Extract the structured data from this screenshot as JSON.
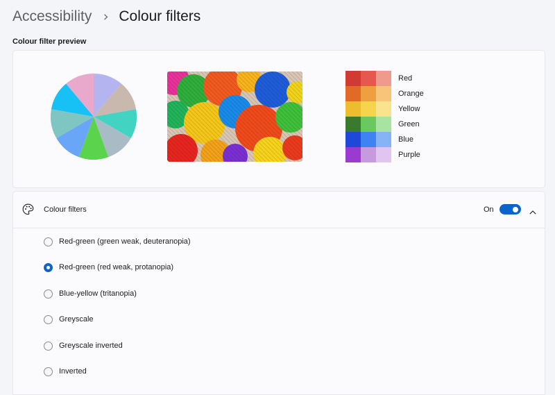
{
  "breadcrumb": {
    "parent": "Accessibility",
    "current": "Colour filters"
  },
  "preview": {
    "section_label": "Colour filter preview",
    "pie_colors": [
      "#b4b4f0",
      "#c9b8ae",
      "#43d3c3",
      "#a9bcc6",
      "#5cd34d",
      "#69a6f7",
      "#7fc5c2",
      "#17c1f5",
      "#e8a9cd"
    ],
    "swatches": [
      {
        "label": "Red",
        "colors": [
          "#d13a33",
          "#e6574e",
          "#ee9a8c"
        ]
      },
      {
        "label": "Orange",
        "colors": [
          "#e06a26",
          "#eea040",
          "#f6c57a"
        ]
      },
      {
        "label": "Yellow",
        "colors": [
          "#ecbd2c",
          "#f6d44c",
          "#f9e38c"
        ]
      },
      {
        "label": "Green",
        "colors": [
          "#3a7a2f",
          "#69c85e",
          "#a8e3a2"
        ]
      },
      {
        "label": "Blue",
        "colors": [
          "#1f48d8",
          "#3f82f2",
          "#86b3f5"
        ]
      },
      {
        "label": "Purple",
        "colors": [
          "#9b3ad0",
          "#c79ae0",
          "#e0c6ee"
        ]
      }
    ]
  },
  "filters": {
    "title": "Colour filters",
    "toggle_label": "On",
    "toggle_on": true,
    "accent": "#0e63c9",
    "options": [
      {
        "label": "Red-green (green weak, deuteranopia)",
        "selected": false
      },
      {
        "label": "Red-green (red weak, protanopia)",
        "selected": true
      },
      {
        "label": "Blue-yellow (tritanopia)",
        "selected": false
      },
      {
        "label": "Greyscale",
        "selected": false
      },
      {
        "label": "Greyscale inverted",
        "selected": false
      },
      {
        "label": "Inverted",
        "selected": false
      }
    ]
  }
}
